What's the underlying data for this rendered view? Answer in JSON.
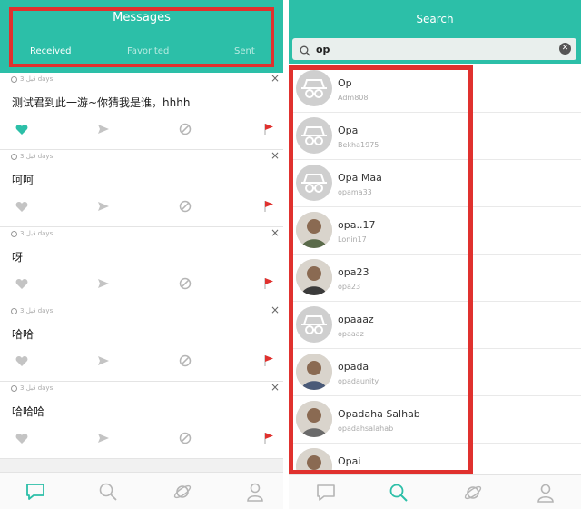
{
  "left": {
    "header": {
      "title": "Messages",
      "tabs": [
        "Received",
        "Favorited",
        "Sent"
      ],
      "active_tab": "Received"
    },
    "messages": [
      {
        "time": "قبل 3 days",
        "text": "测试君到此一游~你猜我是谁，hhhh",
        "liked": true
      },
      {
        "time": "قبل 3 days",
        "text": "呵呵",
        "liked": false
      },
      {
        "time": "قبل 3 days",
        "text": "呀",
        "liked": false
      },
      {
        "time": "قبل 3 days",
        "text": "哈哈",
        "liked": false
      },
      {
        "time": "قبل 3 days",
        "text": "哈哈哈",
        "liked": false
      }
    ],
    "tabbar": [
      "messages-icon",
      "search-icon",
      "planet-icon",
      "profile-icon"
    ],
    "active_tabbar": "messages-icon"
  },
  "right": {
    "header": {
      "title": "Search"
    },
    "search": {
      "value": "op",
      "placeholder": ""
    },
    "results": [
      {
        "name": "Op",
        "username": "Adm808",
        "avatar": "default"
      },
      {
        "name": "Opa",
        "username": "Bekha1975",
        "avatar": "default"
      },
      {
        "name": "Opa Maa",
        "username": "opama33",
        "avatar": "default"
      },
      {
        "name": "opa..17",
        "username": "Lonin17",
        "avatar": "photo"
      },
      {
        "name": "opa23",
        "username": "opa23",
        "avatar": "photo"
      },
      {
        "name": "opaaaz",
        "username": "opaaaz",
        "avatar": "default"
      },
      {
        "name": "opada",
        "username": "opadaunity",
        "avatar": "photo"
      },
      {
        "name": "Opadaha Salhab",
        "username": "opadahsalahab",
        "avatar": "photo"
      },
      {
        "name": "Opai",
        "username": "",
        "avatar": "photo"
      }
    ],
    "tabbar": [
      "messages-icon",
      "search-icon",
      "planet-icon",
      "profile-icon"
    ],
    "active_tabbar": "search-icon"
  },
  "colors": {
    "accent": "#2cbfa8",
    "highlight_box": "#e0312e",
    "flag": "#e0312e",
    "like_active": "#2cbfa8",
    "icon_gray": "#c4c4c4"
  }
}
